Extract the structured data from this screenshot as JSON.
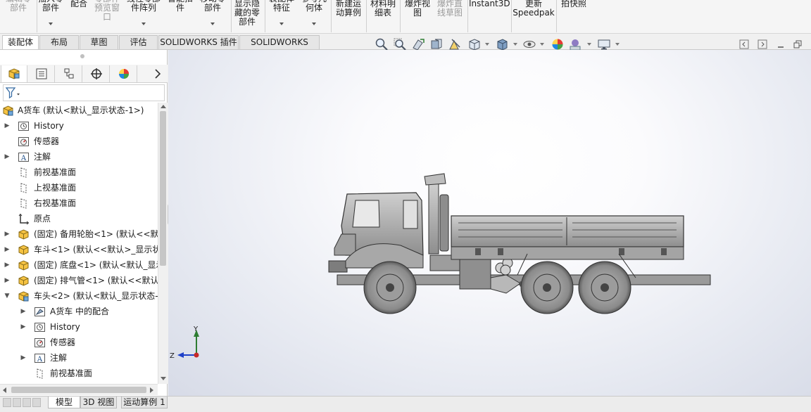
{
  "ribbon": {
    "buttons": [
      {
        "label": "编辑零\n部件",
        "dim": true
      },
      {
        "label": "插入零\n部件",
        "dim": false
      },
      {
        "label": "配合",
        "dim": false
      },
      {
        "label": "零部件\n预览窗\n口",
        "dim": true
      },
      {
        "label": "线性零部\n件阵列",
        "dim": false
      },
      {
        "label": "智能扣\n件",
        "dim": false
      },
      {
        "label": "移动零\n部件",
        "dim": false
      },
      {
        "label": "显示隐\n藏的零\n部件",
        "dim": false
      },
      {
        "label": "装配体\n特征",
        "dim": false
      },
      {
        "label": "参考几\n何体",
        "dim": false
      },
      {
        "label": "新建运\n动算例",
        "dim": false
      },
      {
        "label": "材料明\n细表",
        "dim": false
      },
      {
        "label": "爆炸视\n图",
        "dim": false
      },
      {
        "label": "爆炸直\n线草图",
        "dim": true
      },
      {
        "label": "Instant3D",
        "dim": false
      },
      {
        "label": "更新\nSpeedpak",
        "dim": false
      },
      {
        "label": "拍快照",
        "dim": false
      }
    ]
  },
  "command_tabs": [
    "装配体",
    "布局",
    "草图",
    "评估",
    "SOLIDWORKS 插件",
    "SOLIDWORKS MBD"
  ],
  "tree": {
    "items": [
      {
        "label": "A货车  (默认<默认_显示状态-1>)",
        "icon": "assembly-icon",
        "expander": "",
        "level": 0
      },
      {
        "label": "History",
        "icon": "history-icon",
        "expander": "▶",
        "level": 1
      },
      {
        "label": "传感器",
        "icon": "sensor-icon",
        "expander": "",
        "level": 1
      },
      {
        "label": "注解",
        "icon": "annotation-icon",
        "expander": "▶",
        "level": 1
      },
      {
        "label": "前视基准面",
        "icon": "plane-icon",
        "expander": "",
        "level": 1
      },
      {
        "label": "上视基准面",
        "icon": "plane-icon",
        "expander": "",
        "level": 1
      },
      {
        "label": "右视基准面",
        "icon": "plane-icon",
        "expander": "",
        "level": 1
      },
      {
        "label": "原点",
        "icon": "origin-icon",
        "expander": "",
        "level": 1
      },
      {
        "label": "(固定) 备用轮胎<1> (默认<<默认",
        "icon": "part-icon",
        "expander": "▶",
        "level": 1
      },
      {
        "label": "车斗<1> (默认<<默认>_显示状",
        "icon": "part-icon",
        "expander": "▶",
        "level": 1
      },
      {
        "label": "(固定) 底盘<1> (默认<默认_显示",
        "icon": "part-icon",
        "expander": "▶",
        "level": 1
      },
      {
        "label": "(固定) 排气管<1> (默认<<默认",
        "icon": "part-icon",
        "expander": "▶",
        "level": 1
      },
      {
        "label": "车头<2> (默认<默认_显示状态-",
        "icon": "subassembly-icon",
        "expander": "▼",
        "level": 1
      },
      {
        "label": "A货车 中的配合",
        "icon": "mates-icon",
        "expander": "▶",
        "level": 2
      },
      {
        "label": "History",
        "icon": "history-icon",
        "expander": "▶",
        "level": 2
      },
      {
        "label": "传感器",
        "icon": "sensor-icon",
        "expander": "",
        "level": 2
      },
      {
        "label": "注解",
        "icon": "annotation-icon",
        "expander": "▶",
        "level": 2
      },
      {
        "label": "前视基准面",
        "icon": "plane-icon",
        "expander": "",
        "level": 2
      }
    ]
  },
  "triad": {
    "x_label": "",
    "y_label": "Y",
    "z_label": "Z"
  },
  "bottom_tabs": [
    "模型",
    "3D 视图",
    "运动算例 1"
  ]
}
